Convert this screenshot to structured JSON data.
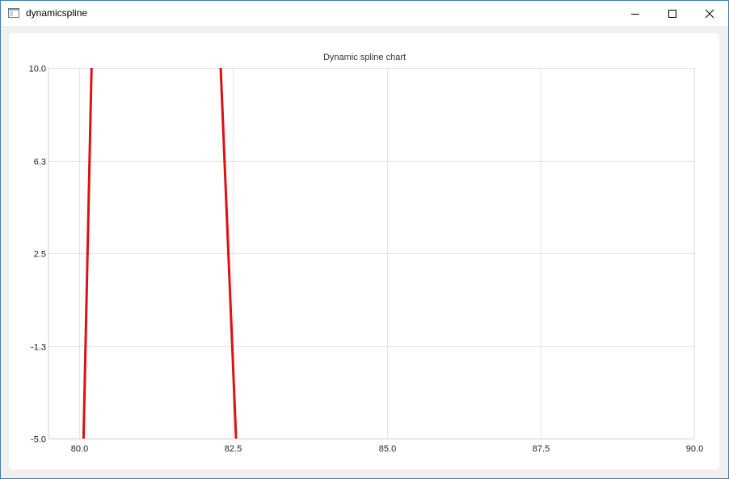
{
  "window": {
    "title": "dynamicspline",
    "icon": "app-window-icon",
    "controls": {
      "minimize_icon": "minimize-icon",
      "maximize_icon": "maximize-icon",
      "close_icon": "close-icon"
    }
  },
  "chart_data": {
    "type": "line",
    "title": "Dynamic spline chart",
    "xlabel": "",
    "ylabel": "",
    "xlim": [
      79.5,
      90.0
    ],
    "ylim": [
      -5.0,
      10.0
    ],
    "x_ticks": [
      "80.0",
      "82.5",
      "85.0",
      "87.5",
      "90.0"
    ],
    "y_ticks": [
      "10.0",
      "6.3",
      "2.5",
      "-1.3",
      "-5.0"
    ],
    "x_tick_values": [
      80.0,
      82.5,
      85.0,
      87.5,
      90.0
    ],
    "y_tick_values": [
      10.0,
      6.25,
      2.5,
      -1.25,
      -5.0
    ],
    "grid": true,
    "legend": "none",
    "series": [
      {
        "color": "#dd1111",
        "segments": [
          [
            [
              80.07,
              -5.0
            ],
            [
              80.14,
              2.5
            ],
            [
              80.2,
              10.0
            ]
          ],
          [
            [
              82.3,
              10.0
            ],
            [
              82.42,
              2.5
            ],
            [
              82.55,
              -5.0
            ]
          ]
        ]
      }
    ],
    "colors": {
      "grid": "#e4e4e4",
      "axis": "#d0d0d0",
      "series": "#dd1111"
    }
  }
}
